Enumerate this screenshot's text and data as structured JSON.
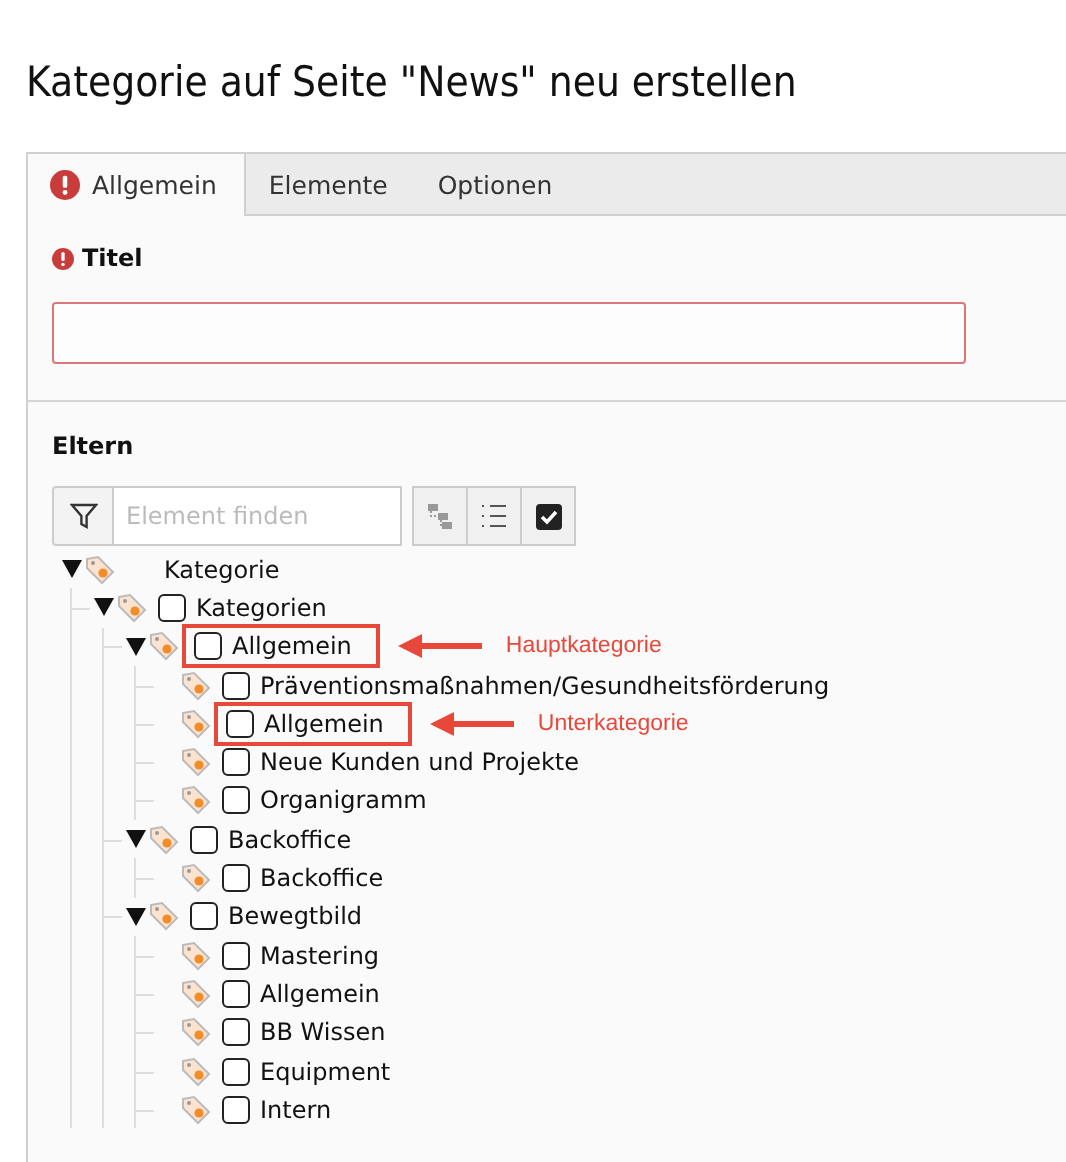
{
  "page_title": "Kategorie auf Seite \"News\" neu erstellen",
  "tabs": [
    {
      "label": "Allgemein",
      "selected": true,
      "error": true
    },
    {
      "label": "Elemente",
      "selected": false,
      "error": false
    },
    {
      "label": "Optionen",
      "selected": false,
      "error": false
    }
  ],
  "title_field": {
    "label": "Titel",
    "error": true
  },
  "parent_section": {
    "label": "Eltern",
    "search": {
      "placeholder": "Element finden"
    }
  },
  "tree": [
    {
      "kind": "root",
      "label": "Kategorie",
      "expanded": true,
      "children": [
        {
          "kind": "category",
          "label": "Kategorien",
          "checked": false,
          "expanded": true,
          "children": [
            {
              "kind": "category",
              "label": "Allgemein",
              "checked": false,
              "expanded": true,
              "highlighted": true,
              "annotation": "Hauptkategorie",
              "children": [
                {
                  "kind": "category",
                  "label": "Präventionsmaßnahmen/Gesundheitsförderung",
                  "checked": false
                },
                {
                  "kind": "category",
                  "label": "Allgemein",
                  "checked": false,
                  "highlighted": true,
                  "annotation": "Unterkategorie"
                },
                {
                  "kind": "category",
                  "label": "Neue Kunden und Projekte",
                  "checked": false
                },
                {
                  "kind": "category",
                  "label": "Organigramm",
                  "checked": false
                }
              ]
            },
            {
              "kind": "category",
              "label": "Backoffice",
              "checked": false,
              "expanded": true,
              "children": [
                {
                  "kind": "category",
                  "label": "Backoffice",
                  "checked": false
                }
              ]
            },
            {
              "kind": "category",
              "label": "Bewegtbild",
              "checked": false,
              "expanded": true,
              "children": [
                {
                  "kind": "category",
                  "label": "Mastering",
                  "checked": false
                },
                {
                  "kind": "category",
                  "label": "Allgemein",
                  "checked": false
                },
                {
                  "kind": "category",
                  "label": "BB Wissen",
                  "checked": false
                },
                {
                  "kind": "category",
                  "label": "Equipment",
                  "checked": false
                },
                {
                  "kind": "category",
                  "label": "Intern",
                  "checked": false
                }
              ]
            }
          ]
        }
      ]
    }
  ]
}
